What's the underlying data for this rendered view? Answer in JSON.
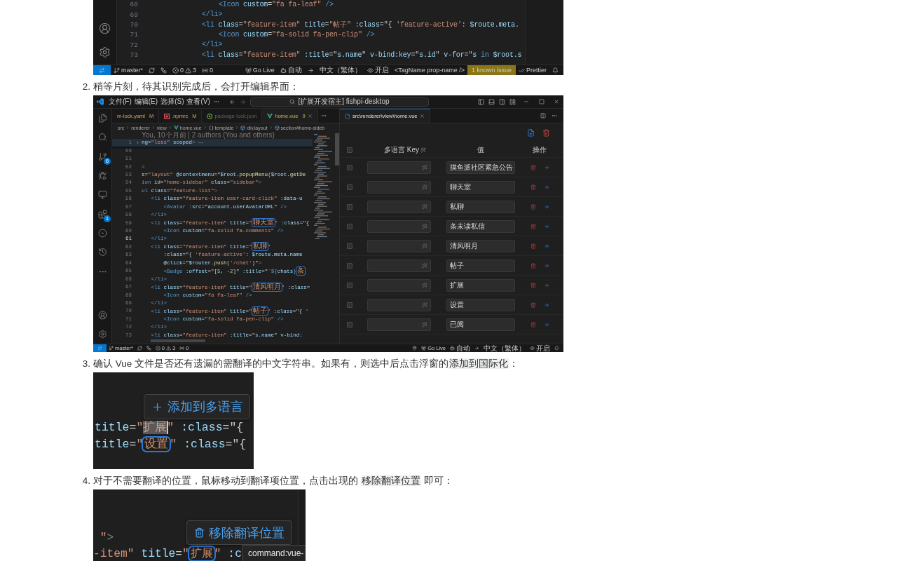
{
  "top_editor": {
    "lines": [
      {
        "number": "68",
        "current": false,
        "tokens": [
          {
            "kind": "tag",
            "text": "    <Icon"
          },
          {
            "kind": "attr",
            "text": " custom"
          },
          {
            "kind": "plain",
            "text": "="
          },
          {
            "kind": "str",
            "text": "\"fa fa-leaf\""
          },
          {
            "kind": "tag",
            "text": " />"
          }
        ]
      },
      {
        "number": "69",
        "current": false,
        "tokens": [
          {
            "kind": "tag",
            "text": "</li>"
          }
        ]
      },
      {
        "number": "70",
        "current": false,
        "tokens": [
          {
            "kind": "tag",
            "text": "<li"
          },
          {
            "kind": "attr",
            "text": " class"
          },
          {
            "kind": "plain",
            "text": "="
          },
          {
            "kind": "str",
            "text": "\"feature-item\""
          },
          {
            "kind": "attr",
            "text": " title"
          },
          {
            "kind": "plain",
            "text": "="
          },
          {
            "kind": "str",
            "text": "\"帖子\""
          },
          {
            "kind": "attr",
            "text": " :class"
          },
          {
            "kind": "plain",
            "text": "=\"{ "
          },
          {
            "kind": "str",
            "text": "'feature-active'"
          },
          {
            "kind": "plain",
            "text": ": "
          },
          {
            "kind": "attr",
            "text": "$route.meta."
          }
        ]
      },
      {
        "number": "71",
        "current": false,
        "tokens": [
          {
            "kind": "tag",
            "text": "    <Icon"
          },
          {
            "kind": "attr",
            "text": " custom"
          },
          {
            "kind": "plain",
            "text": "="
          },
          {
            "kind": "str",
            "text": "\"fa-solid fa-pen-clip\""
          },
          {
            "kind": "tag",
            "text": " />"
          }
        ]
      },
      {
        "number": "72",
        "current": false,
        "tokens": [
          {
            "kind": "tag",
            "text": "</li>"
          }
        ]
      },
      {
        "number": "73",
        "current": false,
        "tokens": [
          {
            "kind": "tag",
            "text": "<li"
          },
          {
            "kind": "attr",
            "text": " class"
          },
          {
            "kind": "plain",
            "text": "="
          },
          {
            "kind": "str",
            "text": "\"feature-item\""
          },
          {
            "kind": "attr",
            "text": " :title"
          },
          {
            "kind": "plain",
            "text": "=\""
          },
          {
            "kind": "attr",
            "text": "s.name"
          },
          {
            "kind": "plain",
            "text": "\""
          },
          {
            "kind": "attr",
            "text": " v-bind:key"
          },
          {
            "kind": "plain",
            "text": "=\""
          },
          {
            "kind": "attr",
            "text": "s.id"
          },
          {
            "kind": "plain",
            "text": "\""
          },
          {
            "kind": "attr",
            "text": " v-for"
          },
          {
            "kind": "plain",
            "text": "=\""
          },
          {
            "kind": "attr",
            "text": "s"
          },
          {
            "kind": "keyword",
            "text": " in "
          },
          {
            "kind": "attr",
            "text": "$root.s"
          }
        ]
      }
    ],
    "status_bar": {
      "branch": "master*",
      "errors": "0",
      "warnings": "3",
      "ports": "0",
      "go_live": "Go Live",
      "copilot": "自动",
      "language": "中文（繁体）",
      "preview": "开启",
      "tag_format": "<TagName prop-name />",
      "issues": "1 known issue",
      "prettier": "Prettier"
    }
  },
  "steps": [
    {
      "number": "2.",
      "text": [
        {
          "kind": "plain",
          "text": "稍等片刻，待其识别完成后，会打开编辑界面："
        }
      ],
      "figure": {
        "kind": "editor",
        "menus": [
          "文件(F)",
          "编辑(E)",
          "选择(S)",
          "查看(V)"
        ],
        "command_center": "[扩展开发宿主] fishpi-desktop",
        "activity_bar": {
          "scm_badge": "6",
          "extensions_badge": "1"
        },
        "tabs": [
          {
            "label": "m-lock.yaml",
            "badge": "M",
            "kind": "modified",
            "selected": false
          },
          {
            "label": ".npmrc",
            "badge": "M",
            "kind": "modified",
            "selected": false
          },
          {
            "label": "package-lock.json",
            "kind": "ignored",
            "selected": false
          },
          {
            "label": "home.vue",
            "badge": "9",
            "kind": "problems",
            "selected": true
          }
        ],
        "breadcrumbs": [
          {
            "kind": "folder",
            "label": "src"
          },
          {
            "kind": "folder",
            "label": "renderer"
          },
          {
            "kind": "folder",
            "label": "view"
          },
          {
            "kind": "vue",
            "label": "home.vue"
          },
          {
            "kind": "braces",
            "label": "template"
          },
          {
            "kind": "element",
            "label": "div.layout"
          },
          {
            "kind": "element",
            "label": "section#home-sideb"
          }
        ],
        "blame": "You, 10个月前 | 2 authors (You and others)",
        "sticky_line": {
          "number": "1",
          "tokens": [
            {
              "kind": "attr",
              "text": "ng"
            },
            {
              "kind": "plain",
              "text": "="
            },
            {
              "kind": "str",
              "text": "\"less\""
            },
            {
              "kind": "attr",
              "text": " scoped"
            },
            {
              "kind": "punct",
              "text": ">"
            }
          ]
        },
        "lines": [
          {
            "number": "50",
            "current": false
          },
          {
            "number": "51",
            "current": false
          },
          {
            "number": "52",
            "current": false,
            "tokens": [
              {
                "kind": "punct",
                "text": ">"
              }
            ]
          },
          {
            "number": "53",
            "current": false,
            "tokens": [
              {
                "kind": "attr",
                "text": "s"
              },
              {
                "kind": "plain",
                "text": "="
              },
              {
                "kind": "str",
                "text": "\"layout\""
              },
              {
                "kind": "attr",
                "text": " @contextmenu"
              },
              {
                "kind": "plain",
                "text": "=\""
              },
              {
                "kind": "attr",
                "text": "$root"
              },
              {
                "kind": "plain",
                "text": "."
              },
              {
                "kind": "fn",
                "text": "popupMenu"
              },
              {
                "kind": "plain",
                "text": "("
              },
              {
                "kind": "attr",
                "text": "$root"
              },
              {
                "kind": "plain",
                "text": "."
              },
              {
                "kind": "fn",
                "text": "getDe"
              }
            ]
          },
          {
            "number": "54",
            "current": false,
            "tokens": [
              {
                "kind": "tag",
                "text": "ion"
              },
              {
                "kind": "attr",
                "text": " id"
              },
              {
                "kind": "plain",
                "text": "="
              },
              {
                "kind": "str",
                "text": "\"home-sidebar\""
              },
              {
                "kind": "attr",
                "text": " class"
              },
              {
                "kind": "plain",
                "text": "="
              },
              {
                "kind": "str",
                "text": "\"sidebar\""
              },
              {
                "kind": "punct",
                "text": ">"
              }
            ]
          },
          {
            "number": "55",
            "current": false,
            "tokens": [
              {
                "kind": "tag",
                "text": "ul"
              },
              {
                "kind": "attr",
                "text": " class"
              },
              {
                "kind": "plain",
                "text": "="
              },
              {
                "kind": "str",
                "text": "\"feature-list\""
              },
              {
                "kind": "punct",
                "text": ">"
              }
            ]
          },
          {
            "number": "56",
            "current": false,
            "tokens": [
              {
                "kind": "tag",
                "text": "   <li"
              },
              {
                "kind": "attr",
                "text": " class"
              },
              {
                "kind": "plain",
                "text": "="
              },
              {
                "kind": "str",
                "text": "\"feature-item user-card-click\""
              },
              {
                "kind": "attr",
                "text": " :data-u"
              }
            ]
          },
          {
            "number": "57",
            "current": false,
            "tokens": [
              {
                "kind": "tag",
                "text": "       <Avatar"
              },
              {
                "kind": "attr",
                "text": " :src"
              },
              {
                "kind": "plain",
                "text": "=\""
              },
              {
                "kind": "attr",
                "text": "account.userAvatarURL"
              },
              {
                "kind": "plain",
                "text": "\""
              },
              {
                "kind": "tag",
                "text": " />"
              }
            ]
          },
          {
            "number": "58",
            "current": false,
            "tokens": [
              {
                "kind": "tag",
                "text": "   </li>"
              }
            ]
          },
          {
            "number": "59",
            "current": false,
            "tokens": [
              {
                "kind": "tag",
                "text": "   <li"
              },
              {
                "kind": "attr",
                "text": " class"
              },
              {
                "kind": "plain",
                "text": "="
              },
              {
                "kind": "str",
                "text": "\"feature-item\""
              },
              {
                "kind": "attr",
                "text": " title"
              },
              {
                "kind": "plain",
                "text": "="
              },
              {
                "kind": "str",
                "text": "\""
              },
              {
                "kind": "mark",
                "text": "聊天室"
              },
              {
                "kind": "str",
                "text": "\""
              },
              {
                "kind": "attr",
                "text": " :class"
              },
              {
                "kind": "plain",
                "text": "=\"{"
              }
            ]
          },
          {
            "number": "60",
            "current": false,
            "tokens": [
              {
                "kind": "tag",
                "text": "       <Icon"
              },
              {
                "kind": "attr",
                "text": " custom"
              },
              {
                "kind": "plain",
                "text": "="
              },
              {
                "kind": "str",
                "text": "\"fa-solid fa-comments\""
              },
              {
                "kind": "tag",
                "text": " />"
              }
            ]
          },
          {
            "number": "61",
            "current": true,
            "tokens": [
              {
                "kind": "tag",
                "text": "   </li>"
              }
            ]
          },
          {
            "number": "62",
            "current": false,
            "tokens": [
              {
                "kind": "tag",
                "text": "   <li"
              },
              {
                "kind": "attr",
                "text": " class"
              },
              {
                "kind": "plain",
                "text": "="
              },
              {
                "kind": "str",
                "text": "\"feature-item\""
              },
              {
                "kind": "attr",
                "text": " title"
              },
              {
                "kind": "plain",
                "text": "="
              },
              {
                "kind": "str",
                "text": "\""
              },
              {
                "kind": "mark",
                "text": "私聊"
              },
              {
                "kind": "str",
                "text": "\""
              }
            ]
          },
          {
            "number": "63",
            "current": false,
            "tokens": [
              {
                "kind": "attr",
                "text": "       :class"
              },
              {
                "kind": "plain",
                "text": "=\"{ "
              },
              {
                "kind": "str",
                "text": "'feature-active'"
              },
              {
                "kind": "plain",
                "text": ": "
              },
              {
                "kind": "attr",
                "text": "$route.meta.name"
              }
            ]
          },
          {
            "number": "64",
            "current": false,
            "tokens": [
              {
                "kind": "attr",
                "text": "       @click"
              },
              {
                "kind": "plain",
                "text": "=\""
              },
              {
                "kind": "attr",
                "text": "$router"
              },
              {
                "kind": "plain",
                "text": "."
              },
              {
                "kind": "fn",
                "text": "push"
              },
              {
                "kind": "plain",
                "text": "("
              },
              {
                "kind": "str",
                "text": "'/chat'"
              },
              {
                "kind": "plain",
                "text": ")\""
              },
              {
                "kind": "punct",
                "text": ">"
              }
            ]
          },
          {
            "number": "65",
            "current": false,
            "tokens": [
              {
                "kind": "tag",
                "text": "       <Badge"
              },
              {
                "kind": "attr",
                "text": " :offset"
              },
              {
                "kind": "plain",
                "text": "=\"["
              },
              {
                "kind": "num",
                "text": "5"
              },
              {
                "kind": "plain",
                "text": ", "
              },
              {
                "kind": "num",
                "text": "-2"
              },
              {
                "kind": "plain",
                "text": "]\""
              },
              {
                "kind": "attr",
                "text": " :title"
              },
              {
                "kind": "plain",
                "text": "=\""
              },
              {
                "kind": "str",
                "text": "`"
              },
              {
                "kind": "keyword",
                "text": "${"
              },
              {
                "kind": "attr",
                "text": "chats"
              },
              {
                "kind": "keyword",
                "text": "}"
              },
              {
                "kind": "mark",
                "text": "条"
              }
            ]
          },
          {
            "number": "66",
            "current": false,
            "tokens": [
              {
                "kind": "tag",
                "text": "   </li>"
              }
            ]
          },
          {
            "number": "67",
            "current": false,
            "tokens": [
              {
                "kind": "tag",
                "text": "   <li"
              },
              {
                "kind": "attr",
                "text": " class"
              },
              {
                "kind": "plain",
                "text": "="
              },
              {
                "kind": "str",
                "text": "\"feature-item\""
              },
              {
                "kind": "attr",
                "text": " title"
              },
              {
                "kind": "plain",
                "text": "="
              },
              {
                "kind": "str",
                "text": "\""
              },
              {
                "kind": "mark",
                "text": "清风明月"
              },
              {
                "kind": "str",
                "text": "\""
              },
              {
                "kind": "attr",
                "text": " :class"
              },
              {
                "kind": "plain",
                "text": "="
              }
            ]
          },
          {
            "number": "68",
            "current": false,
            "tokens": [
              {
                "kind": "tag",
                "text": "       <Icon"
              },
              {
                "kind": "attr",
                "text": " custom"
              },
              {
                "kind": "plain",
                "text": "="
              },
              {
                "kind": "str",
                "text": "\"fa fa-leaf\""
              },
              {
                "kind": "tag",
                "text": " />"
              }
            ]
          },
          {
            "number": "69",
            "current": false,
            "tokens": [
              {
                "kind": "tag",
                "text": "   </li>"
              }
            ]
          },
          {
            "number": "70",
            "current": false,
            "tokens": [
              {
                "kind": "tag",
                "text": "   <li"
              },
              {
                "kind": "attr",
                "text": " class"
              },
              {
                "kind": "plain",
                "text": "="
              },
              {
                "kind": "str",
                "text": "\"feature-item\""
              },
              {
                "kind": "attr",
                "text": " title"
              },
              {
                "kind": "plain",
                "text": "="
              },
              {
                "kind": "str",
                "text": "\""
              },
              {
                "kind": "mark",
                "text": "帖子"
              },
              {
                "kind": "str",
                "text": "\""
              },
              {
                "kind": "attr",
                "text": " :class"
              },
              {
                "kind": "plain",
                "text": "=\"{ "
              },
              {
                "kind": "str",
                "text": "'"
              }
            ]
          },
          {
            "number": "71",
            "current": false,
            "tokens": [
              {
                "kind": "tag",
                "text": "       <Icon"
              },
              {
                "kind": "attr",
                "text": " custom"
              },
              {
                "kind": "plain",
                "text": "="
              },
              {
                "kind": "str",
                "text": "\"fa-solid fa-pen-clip\""
              },
              {
                "kind": "tag",
                "text": " />"
              }
            ]
          },
          {
            "number": "72",
            "current": false,
            "tokens": [
              {
                "kind": "tag",
                "text": "   </li>"
              }
            ]
          },
          {
            "number": "73",
            "current": false,
            "tokens": [
              {
                "kind": "tag",
                "text": "   <li"
              },
              {
                "kind": "attr",
                "text": " class"
              },
              {
                "kind": "plain",
                "text": "="
              },
              {
                "kind": "str",
                "text": "\"feature-item\""
              },
              {
                "kind": "attr",
                "text": " :title"
              },
              {
                "kind": "plain",
                "text": "=\""
              },
              {
                "kind": "attr",
                "text": "s.name"
              },
              {
                "kind": "plain",
                "text": "\""
              },
              {
                "kind": "attr",
                "text": " v-bind:"
              }
            ]
          }
        ],
        "right_tab": {
          "label": "src\\renderer\\view\\home.vue",
          "selected": true
        },
        "table": {
          "all_checked": false,
          "columns": [
            "多语言 Key",
            "值",
            "操作"
          ],
          "rows": [
            {
              "checked": false,
              "value": "摸鱼派社区紧急公告"
            },
            {
              "checked": false,
              "value": "聊天室"
            },
            {
              "checked": false,
              "value": "私聊"
            },
            {
              "checked": false,
              "value": "条未读私信"
            },
            {
              "checked": false,
              "value": "清风明月"
            },
            {
              "checked": false,
              "value": "帖子"
            },
            {
              "checked": false,
              "value": "扩展"
            },
            {
              "checked": false,
              "value": "设置"
            },
            {
              "checked": false,
              "value": "已阅"
            }
          ]
        },
        "status_bar": {
          "branch": "master*",
          "errors": "0",
          "warnings": "3",
          "ports": "0",
          "pin": true,
          "go_live": "Go Live",
          "copilot": "自动",
          "language": "中文（繁体）",
          "preview": "开启"
        }
      }
    },
    {
      "number": "3.",
      "text": [
        {
          "kind": "plain",
          "text": "确认 Vue 文件是否还有遗漏的需翻译的中文字符串。如果有，则选中后点击浮窗的"
        },
        {
          "kind": "code",
          "text": "添加到国际化"
        },
        {
          "kind": "plain",
          "text": "："
        }
      ],
      "figure": {
        "kind": "snippet",
        "popup": {
          "kind": "add",
          "label": "添加到多语言"
        },
        "lines": [
          {
            "tokens": [
              {
                "kind": "attr",
                "text": "title"
              },
              {
                "kind": "plain",
                "text": "="
              },
              {
                "kind": "str",
                "text": "\""
              },
              {
                "kind": "selected",
                "text": "扩展"
              },
              {
                "kind": "str",
                "text": "\""
              },
              {
                "kind": "attr",
                "text": " :class"
              },
              {
                "kind": "plain",
                "text": "=\"{"
              }
            ]
          },
          {
            "tokens": [
              {
                "kind": "attr",
                "text": "title"
              },
              {
                "kind": "plain",
                "text": "="
              },
              {
                "kind": "str",
                "text": "\""
              },
              {
                "kind": "mark",
                "text": "设置"
              },
              {
                "kind": "str",
                "text": "\""
              },
              {
                "kind": "attr",
                "text": " :class"
              },
              {
                "kind": "plain",
                "text": "=\"{"
              }
            ]
          }
        ]
      }
    },
    {
      "number": "4.",
      "text": [
        {
          "kind": "plain",
          "text": "对于不需要翻译的位置，鼠标移动到翻译项位置，点击出现的 "
        },
        {
          "kind": "code",
          "text": "移除翻译位置"
        },
        {
          "kind": "plain",
          "text": " 即可："
        }
      ],
      "figure": {
        "kind": "snippet",
        "popup": {
          "kind": "remove",
          "label": "移除翻译位置"
        },
        "lines": [
          {
            "tokens": [
              {
                "kind": "str",
                "text": " \""
              },
              {
                "kind": "punct",
                "text": ">"
              }
            ]
          },
          {
            "tokens": [
              {
                "kind": "str",
                "text": "-item\""
              },
              {
                "kind": "attr",
                "text": " title"
              },
              {
                "kind": "plain",
                "text": "="
              },
              {
                "kind": "str",
                "text": "\""
              },
              {
                "kind": "mark",
                "text": "扩展"
              },
              {
                "kind": "str",
                "text": "\""
              },
              {
                "kind": "attr",
                "text": " :c"
              }
            ]
          }
        ],
        "tooltip": "command:vue-",
        "minimap": true
      }
    }
  ]
}
